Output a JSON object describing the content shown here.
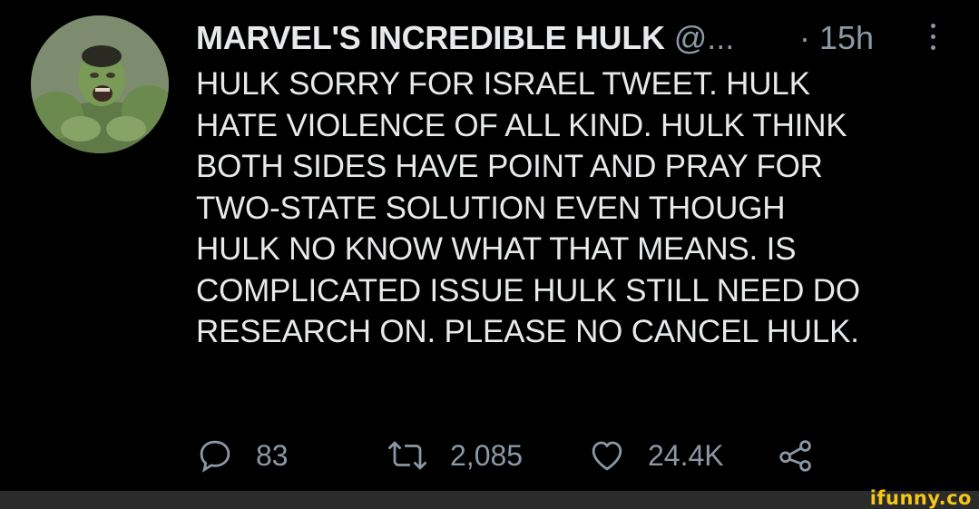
{
  "tweet": {
    "display_name": "MARVEL'S INCREDIBLE HULK",
    "handle": "@...",
    "time": "· 15h",
    "text": "HULK SORRY FOR ISRAEL TWEET. HULK\nHATE VIOLENCE OF ALL KIND. HULK THINK\nBOTH SIDES HAVE POINT AND PRAY FOR\nTWO-STATE SOLUTION EVEN THOUGH\nHULK NO KNOW WHAT THAT MEANS. IS\nCOMPLICATED ISSUE HULK STILL NEED DO\nRESEARCH ON. PLEASE NO CANCEL HULK.",
    "actions": {
      "reply_count": "83",
      "retweet_count": "2,085",
      "like_count": "24.4K"
    }
  },
  "icons": {
    "reply": "reply-icon",
    "retweet": "retweet-icon",
    "like": "heart-icon",
    "share": "share-icon",
    "more": "more-vertical-icon",
    "avatar": "avatar"
  },
  "colors": {
    "background": "#000000",
    "text": "#e7e9ea",
    "secondary": "#8b98a5",
    "watermark": "#f5c518"
  },
  "watermark": "ifunny.co"
}
